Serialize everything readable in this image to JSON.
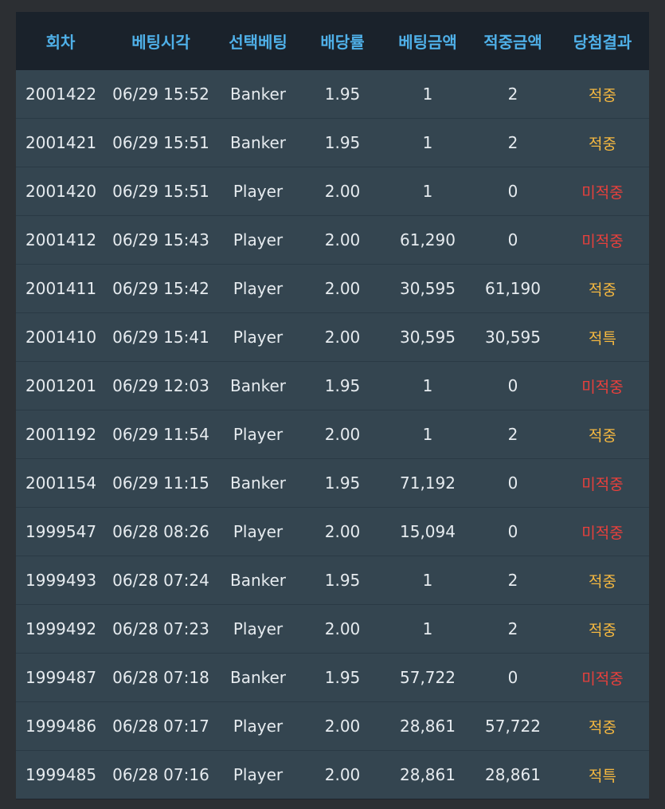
{
  "table": {
    "headers": {
      "round": "회차",
      "bet_time": "베팅시각",
      "selection": "선택베팅",
      "odds": "배당률",
      "bet_amount": "베팅금액",
      "win_amount": "적중금액",
      "result": "당첨결과"
    },
    "rows": [
      {
        "round": "2001422",
        "time": "06/29 15:52",
        "selection": "Banker",
        "odds": "1.95",
        "bet": "1",
        "win": "2",
        "result": "적중",
        "status": "win"
      },
      {
        "round": "2001421",
        "time": "06/29 15:51",
        "selection": "Banker",
        "odds": "1.95",
        "bet": "1",
        "win": "2",
        "result": "적중",
        "status": "win"
      },
      {
        "round": "2001420",
        "time": "06/29 15:51",
        "selection": "Player",
        "odds": "2.00",
        "bet": "1",
        "win": "0",
        "result": "미적중",
        "status": "lose"
      },
      {
        "round": "2001412",
        "time": "06/29 15:43",
        "selection": "Player",
        "odds": "2.00",
        "bet": "61,290",
        "win": "0",
        "result": "미적중",
        "status": "lose"
      },
      {
        "round": "2001411",
        "time": "06/29 15:42",
        "selection": "Player",
        "odds": "2.00",
        "bet": "30,595",
        "win": "61,190",
        "result": "적중",
        "status": "win"
      },
      {
        "round": "2001410",
        "time": "06/29 15:41",
        "selection": "Player",
        "odds": "2.00",
        "bet": "30,595",
        "win": "30,595",
        "result": "적특",
        "status": "special"
      },
      {
        "round": "2001201",
        "time": "06/29 12:03",
        "selection": "Banker",
        "odds": "1.95",
        "bet": "1",
        "win": "0",
        "result": "미적중",
        "status": "lose"
      },
      {
        "round": "2001192",
        "time": "06/29 11:54",
        "selection": "Player",
        "odds": "2.00",
        "bet": "1",
        "win": "2",
        "result": "적중",
        "status": "win"
      },
      {
        "round": "2001154",
        "time": "06/29 11:15",
        "selection": "Banker",
        "odds": "1.95",
        "bet": "71,192",
        "win": "0",
        "result": "미적중",
        "status": "lose"
      },
      {
        "round": "1999547",
        "time": "06/28 08:26",
        "selection": "Player",
        "odds": "2.00",
        "bet": "15,094",
        "win": "0",
        "result": "미적중",
        "status": "lose"
      },
      {
        "round": "1999493",
        "time": "06/28 07:24",
        "selection": "Banker",
        "odds": "1.95",
        "bet": "1",
        "win": "2",
        "result": "적중",
        "status": "win"
      },
      {
        "round": "1999492",
        "time": "06/28 07:23",
        "selection": "Player",
        "odds": "2.00",
        "bet": "1",
        "win": "2",
        "result": "적중",
        "status": "win"
      },
      {
        "round": "1999487",
        "time": "06/28 07:18",
        "selection": "Banker",
        "odds": "1.95",
        "bet": "57,722",
        "win": "0",
        "result": "미적중",
        "status": "lose"
      },
      {
        "round": "1999486",
        "time": "06/28 07:17",
        "selection": "Player",
        "odds": "2.00",
        "bet": "28,861",
        "win": "57,722",
        "result": "적중",
        "status": "win"
      },
      {
        "round": "1999485",
        "time": "06/28 07:16",
        "selection": "Player",
        "odds": "2.00",
        "bet": "28,861",
        "win": "28,861",
        "result": "적특",
        "status": "special"
      }
    ]
  },
  "colors": {
    "header_text": "#4fb0e8",
    "win": "#f5b840",
    "lose": "#e8403c",
    "row_bg": "#344550"
  }
}
